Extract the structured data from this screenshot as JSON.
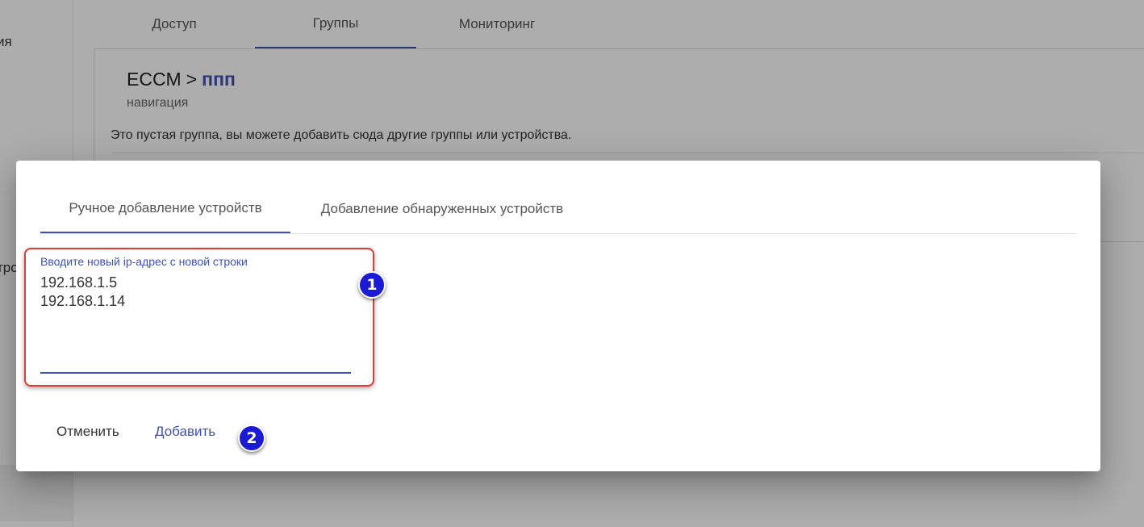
{
  "sidebar": {
    "items": [
      {
        "label": "ия"
      },
      {
        "label": "тро"
      }
    ]
  },
  "main_tabs": [
    {
      "label": "Доступ"
    },
    {
      "label": "Группы",
      "active": true
    },
    {
      "label": "Мониторинг"
    }
  ],
  "card": {
    "breadcrumb_root": "ECCM",
    "breadcrumb_sep": ">",
    "breadcrumb_current": "ппп",
    "subtitle": "навигация",
    "empty_message": "Это пустая группа, вы можете добавить сюда другие группы или устройства."
  },
  "dialog": {
    "tabs": [
      {
        "label": "Ручное добавление устройств",
        "active": true
      },
      {
        "label": "Добавление обнаруженных устройств"
      }
    ],
    "field_label": "Вводите новый ip-адрес с новой строки",
    "field_value": "192.168.1.5\n192.168.1.14",
    "cancel_label": "Отменить",
    "add_label": "Добавить"
  },
  "annotations": {
    "badge_1": "1",
    "badge_2": "2"
  },
  "colors": {
    "accent": "#3f51b5",
    "highlight": "#e53935",
    "badge": "#1a1ad4"
  }
}
